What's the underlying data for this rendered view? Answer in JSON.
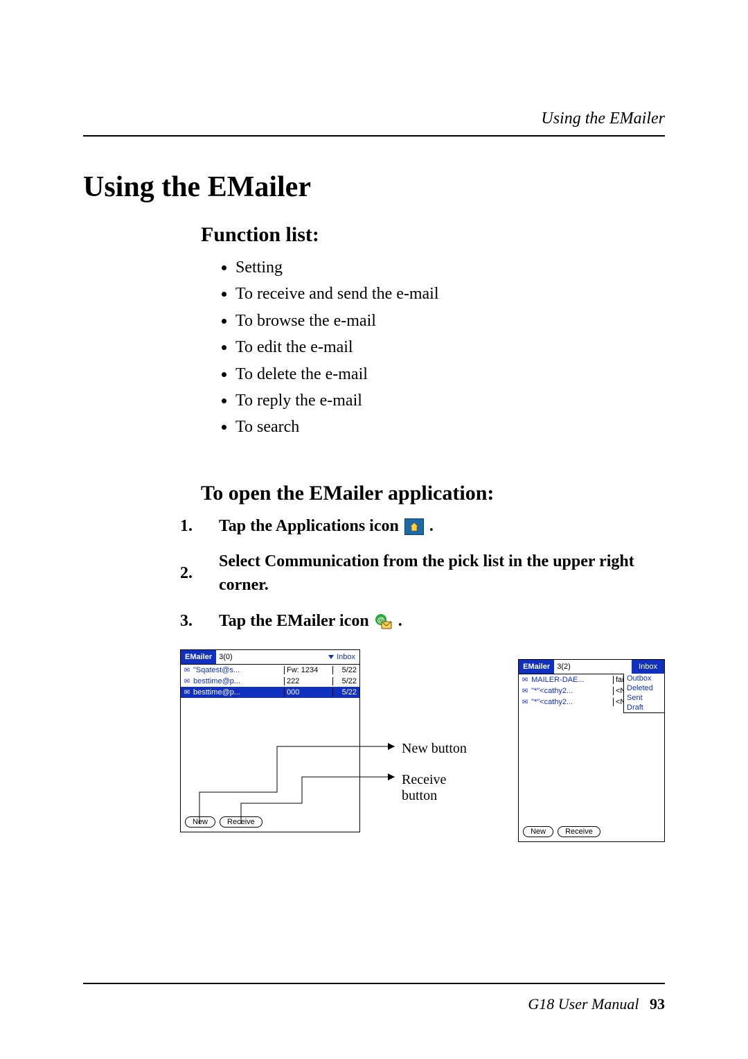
{
  "header": {
    "running_head": "Using the EMailer"
  },
  "title": "Using the EMailer",
  "section_function_list": "Function list:",
  "function_items": [
    "Setting",
    "To receive and send the e-mail",
    "To browse the e-mail",
    "To edit the e-mail",
    "To delete the e-mail",
    "To reply the e-mail",
    "To search"
  ],
  "section_open": "To open the EMailer application:",
  "steps": {
    "s1_num": "1.",
    "s1_pre": "Tap the Applications icon",
    "s1_post": " .",
    "s2_num": "2.",
    "s2_text": "Select Communication from the pick list in the upper right corner.",
    "s3_num": "3.",
    "s3_pre": "Tap the EMailer icon",
    "s3_post": " ."
  },
  "callouts": {
    "new": "New button",
    "receive": "Receive button"
  },
  "screens": {
    "left": {
      "app_name": "EMailer",
      "count": "3(0)",
      "picker": "Inbox",
      "rows": [
        {
          "from": "\"Sqatest@s...",
          "subj": "Fw: 1234",
          "date": "5/22",
          "sel": false,
          "icon": "envelope-open"
        },
        {
          "from": "besttime@p...",
          "subj": "222",
          "date": "5/22",
          "sel": false,
          "icon": "envelope-open"
        },
        {
          "from": "besttime@p...",
          "subj": "000",
          "date": "5/22",
          "sel": true,
          "icon": "envelope-open"
        }
      ],
      "btn_new": "New",
      "btn_receive": "Receive"
    },
    "right": {
      "app_name": "EMailer",
      "count": "3(2)",
      "picker": "Inbox",
      "dropdown": [
        "Outbox",
        "Deleted",
        "Sent",
        "Draft"
      ],
      "rows": [
        {
          "from": "MAILER-DAE...",
          "subj": "failure no",
          "icon": "envelope-open"
        },
        {
          "from": "\"*\"<cathy2...",
          "subj": "<No Subje",
          "icon": "envelope-closed"
        },
        {
          "from": "\"*\"<cathy2...",
          "subj": "<No Subje",
          "icon": "envelope-closed"
        }
      ],
      "btn_new": "New",
      "btn_receive": "Receive"
    }
  },
  "footer": {
    "manual": "G18 User Manual",
    "page": "93"
  }
}
